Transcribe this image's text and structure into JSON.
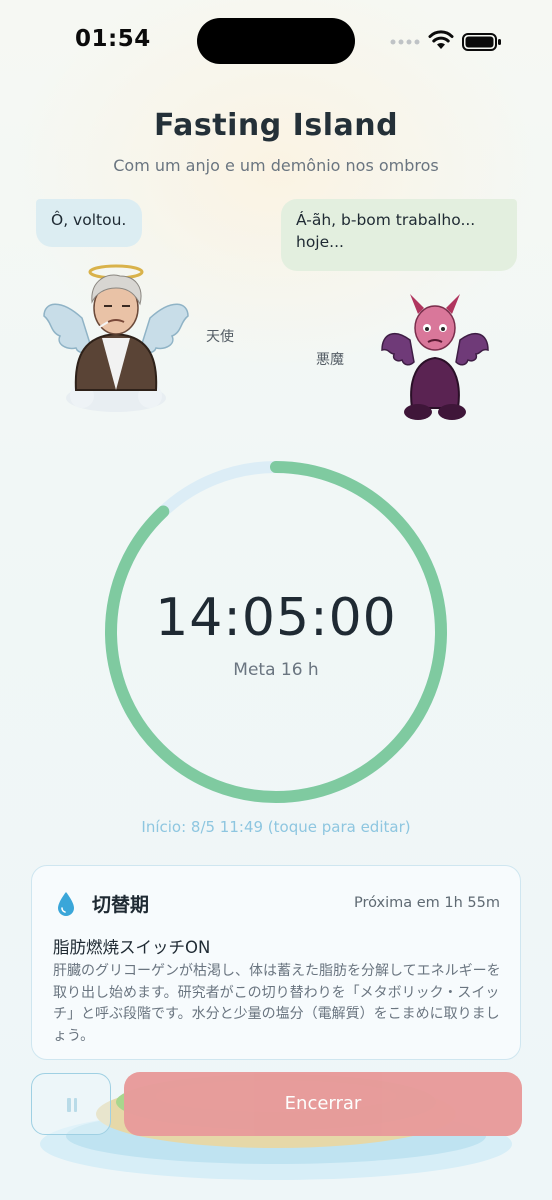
{
  "status_bar": {
    "time": "01:54",
    "icons": [
      "signal-icon",
      "wifi-icon",
      "battery-icon"
    ]
  },
  "header": {
    "title": "Fasting Island",
    "subtitle": "Com um anjo e um demônio nos ombros"
  },
  "characters": {
    "angel": {
      "speech": "Ô, voltou.",
      "label": "天使",
      "icon": "angel-character"
    },
    "devil": {
      "speech": "Á-ãh, b-bom trabalho... hoje...",
      "label": "悪魔",
      "icon": "devil-character"
    }
  },
  "timer": {
    "elapsed": "14:05:00",
    "goal_label": "Meta 16 h",
    "progress": 0.88,
    "start_text": "Início: 8/5 11:49 (toque para editar)",
    "colors": {
      "progress": "#7fcaa0",
      "track": "#dcedf6"
    }
  },
  "phase": {
    "icon": "water-drop-icon",
    "name": "切替期",
    "next": "Próxima em 1h 55m",
    "title": "脂肪燃焼スイッチON",
    "description": "肝臓のグリコーゲンが枯渇し、体は蓄えた脂肪を分解してエネルギーを取り出し始めます。研究者がこの切り替わりを「メタボリック・スイッチ」と呼ぶ段階です。水分と少量の塩分（電解質）をこまめに取りましょう。"
  },
  "actions": {
    "pause_icon": "pause-icon",
    "end_label": "Encerrar",
    "end_color": "#e89b9b"
  }
}
